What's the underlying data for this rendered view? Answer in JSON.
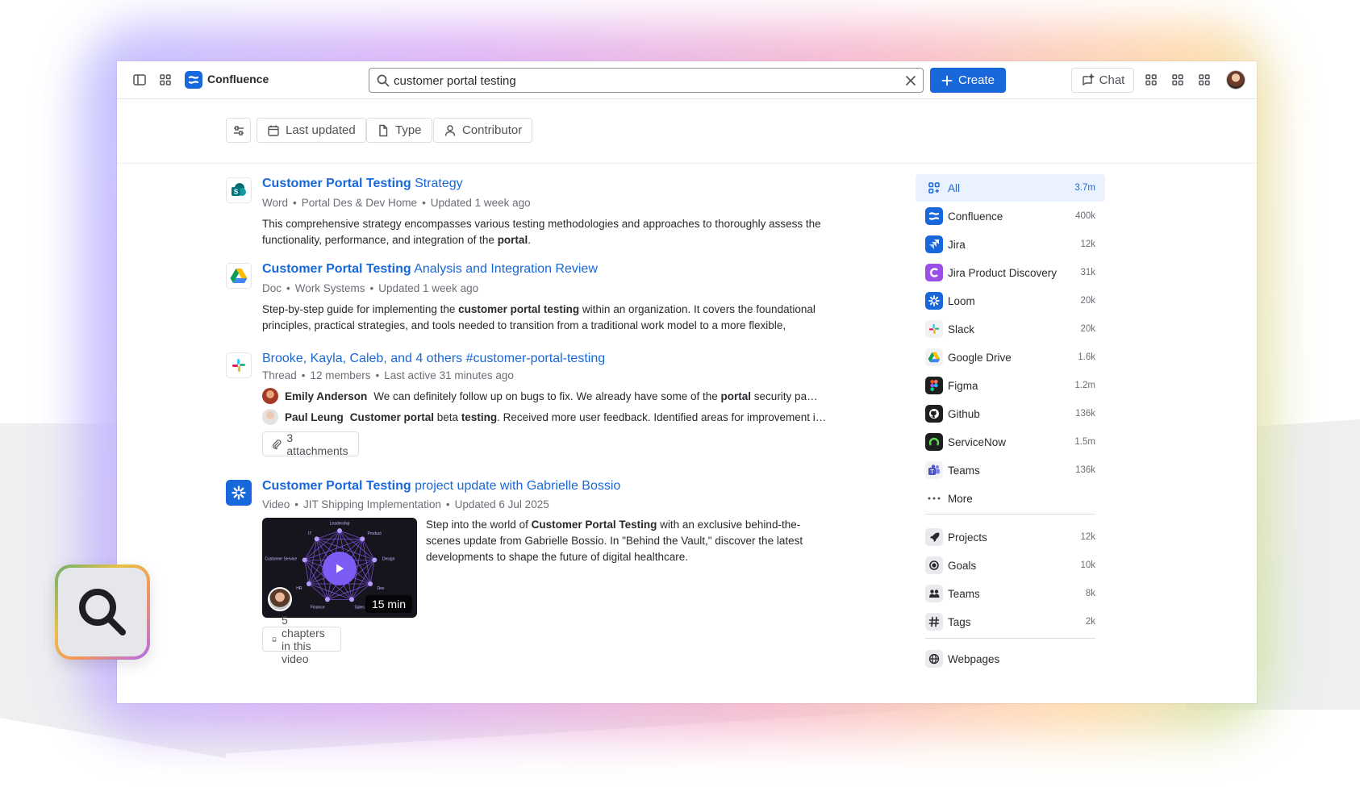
{
  "topnav": {
    "product_name": "Confluence",
    "search_value": "customer portal testing",
    "create_label": "Create",
    "chat_label": "Chat"
  },
  "filters": {
    "last_updated": "Last updated",
    "type": "Type",
    "contributor": "Contributor"
  },
  "results": [
    {
      "title_bold": "Customer Portal Testing",
      "title_rest": " Strategy",
      "meta": [
        "Word",
        "Portal Des & Dev Home",
        "Updated 1 week ago"
      ],
      "desc_a": "This comprehensive strategy encompasses various testing methodologies and approaches to thoroughly assess the functionality, performance, and integration of the ",
      "desc_b": "portal",
      "desc_c": "."
    },
    {
      "title_bold": "Customer Portal Testing",
      "title_rest": " Analysis and Integration Review",
      "meta": [
        "Doc",
        "Work Systems",
        "Updated 1 week ago"
      ],
      "desc_a": "Step-by-step guide for implementing the ",
      "desc_b": "customer portal testing",
      "desc_c": " within an organization. It covers the foundational principles, practical strategies, and tools needed to transition from a traditional work model to a more flexible,"
    },
    {
      "title": "Brooke, Kayla, Caleb, and 4 others #customer-portal-testing",
      "meta": [
        "Thread",
        "12 members",
        "Last active 31 minutes ago"
      ],
      "messages": [
        {
          "author": "Emily Anderson",
          "text_a": "We can definitely follow up on bugs to fix. We already have some of the ",
          "text_b": "portal",
          "text_c": " security pa…"
        },
        {
          "author": "Paul Leung",
          "text_a": "",
          "text_b": "Customer portal",
          "text_c": " beta ",
          "text_d": "testing",
          "text_e": ". Received more user feedback. Identified areas for improvement i…"
        }
      ],
      "attachments": "3 attachments"
    },
    {
      "title_bold": "Customer Portal Testing",
      "title_rest": " project update with Gabrielle Bossio",
      "meta": [
        "Video",
        "JIT Shipping Implementation",
        "Updated 6 Jul 2025"
      ],
      "desc_a": "Step into the world of ",
      "desc_b": "Customer Portal Testing",
      "desc_c": " with an exclusive behind-the-scenes update from Gabrielle Bossio. In \"Behind the Vault,\" discover the latest developments to shape the future of digital healthcare.",
      "duration": "15 min",
      "chapters": "5 chapters in this video",
      "thumb_labels": [
        "Leadership",
        "Product",
        "Design",
        "Dev",
        "Sales",
        "Finance",
        "HR",
        "Customer Service",
        "IT"
      ]
    }
  ],
  "sidebar": {
    "sources": [
      {
        "label": "All",
        "count": "3.7m",
        "icon": "grid-icon"
      },
      {
        "label": "Confluence",
        "count": "400k",
        "icon": "confluence-icon"
      },
      {
        "label": "Jira",
        "count": "12k",
        "icon": "jira-icon"
      },
      {
        "label": "Jira Product Discovery",
        "count": "31k",
        "icon": "jpd-icon"
      },
      {
        "label": "Loom",
        "count": "20k",
        "icon": "loom-icon"
      },
      {
        "label": "Slack",
        "count": "20k",
        "icon": "slack-icon"
      },
      {
        "label": "Google Drive",
        "count": "1.6k",
        "icon": "google-drive-icon"
      },
      {
        "label": "Figma",
        "count": "1.2m",
        "icon": "figma-icon"
      },
      {
        "label": "Github",
        "count": "136k",
        "icon": "github-icon"
      },
      {
        "label": "ServiceNow",
        "count": "1.5m",
        "icon": "servicenow-icon"
      },
      {
        "label": "Teams",
        "count": "136k",
        "icon": "teams-icon"
      },
      {
        "label": "More",
        "count": "",
        "icon": "more-icon"
      }
    ],
    "entities": [
      {
        "label": "Projects",
        "count": "12k",
        "icon": "rocket-icon"
      },
      {
        "label": "Goals",
        "count": "10k",
        "icon": "target-icon"
      },
      {
        "label": "Teams",
        "count": "8k",
        "icon": "people-icon"
      },
      {
        "label": "Tags",
        "count": "2k",
        "icon": "hash-icon"
      }
    ],
    "webpages": "Webpages"
  },
  "colors": {
    "brand": "#1868DB",
    "active_bg": "#E9F2FE"
  }
}
